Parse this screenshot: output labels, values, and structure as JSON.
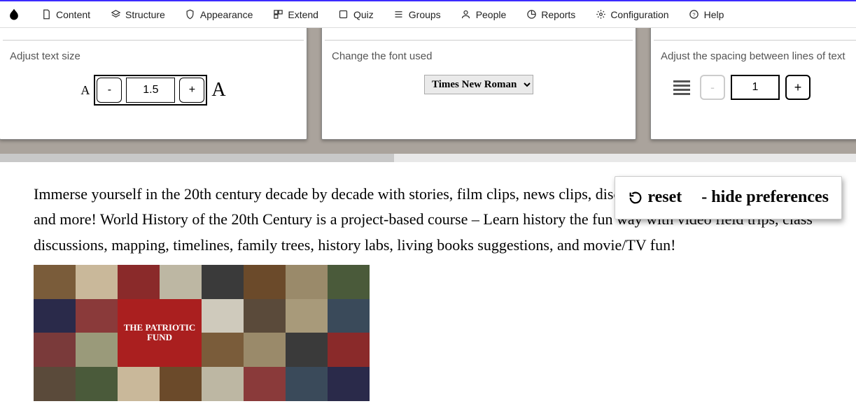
{
  "nav": {
    "items": [
      {
        "label": "Content"
      },
      {
        "label": "Structure"
      },
      {
        "label": "Appearance"
      },
      {
        "label": "Extend"
      },
      {
        "label": "Quiz"
      },
      {
        "label": "Groups"
      },
      {
        "label": "People"
      },
      {
        "label": "Reports"
      },
      {
        "label": "Configuration"
      },
      {
        "label": "Help"
      }
    ]
  },
  "prefs": {
    "textSize": {
      "label": "Adjust text size",
      "value": "1.5",
      "minus": "-",
      "plus": "+"
    },
    "font": {
      "label": "Change the font used",
      "selected": "Times New Roman"
    },
    "lineSpacing": {
      "label": "Adjust the spacing between lines of text",
      "value": "1",
      "minus": "-",
      "plus": "+"
    }
  },
  "floatPanel": {
    "reset": "reset",
    "hide": "- hide preferences"
  },
  "content": {
    "paragraph": "Immerse yourself in the 20th century decade by decade with stories, film clips, news clips, discussions, mapping, family trees, and more! World History of the 20th Century is a project-based course – Learn history the fun way with video field trips, class discussions, mapping, timelines, family trees, history labs, living books suggestions, and movie/TV fun!",
    "collageBadge": "THE PATRIOTIC FUND"
  }
}
